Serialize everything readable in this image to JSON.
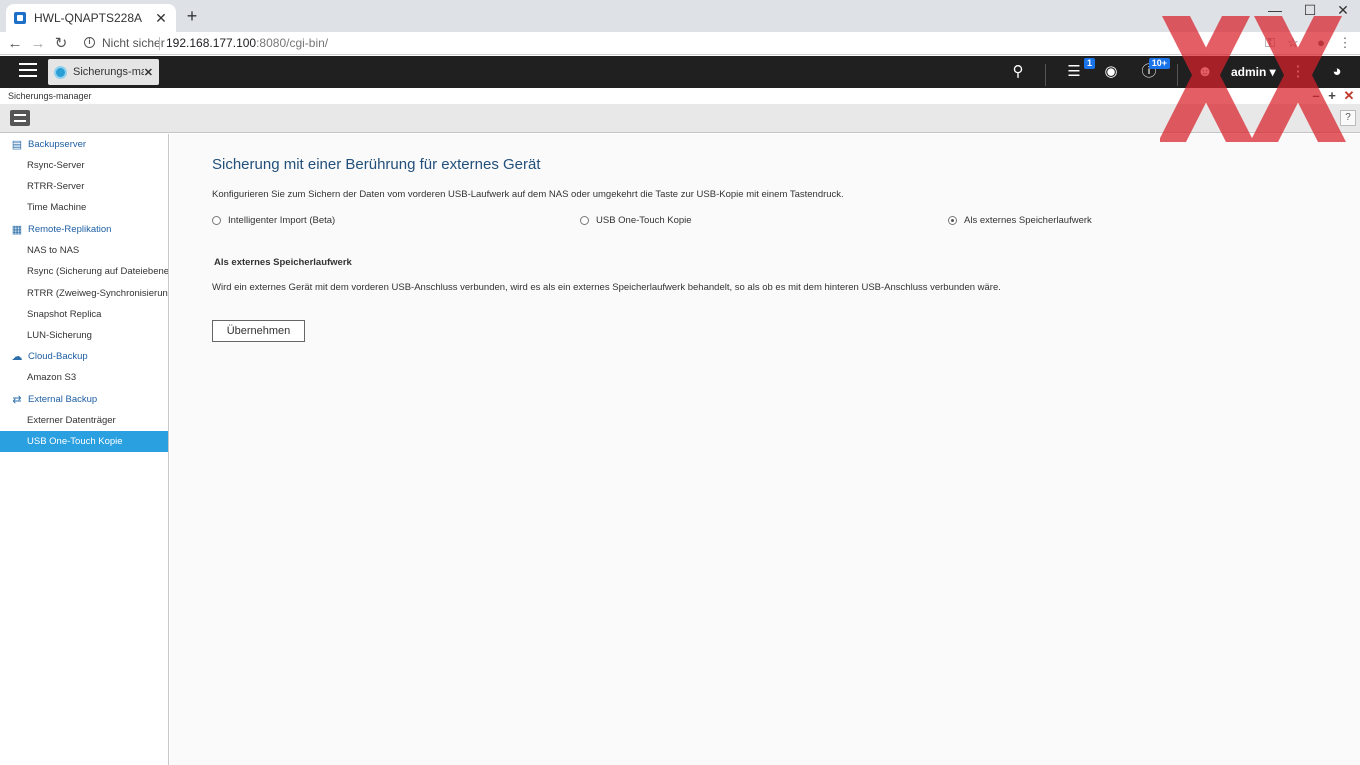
{
  "browser": {
    "tab_title": "HWL-QNAPTS228A",
    "tab_close": "✕",
    "new_tab": "+",
    "window_controls": {
      "minimize": "—",
      "maximize": "☐",
      "close": "✕"
    },
    "not_secure": "Nicht sicher",
    "url_host": "192.168.177.100",
    "url_rest": ":8080/cgi-bin/",
    "icons": [
      "back-icon",
      "forward-icon",
      "reload-icon",
      "info-icon",
      "key-icon",
      "star-icon",
      "profile-icon",
      "menu-icon"
    ]
  },
  "qts": {
    "app_tab_label": "Sicherungs-ma...",
    "app_tab_close": "✕",
    "badges": {
      "tasks": "1",
      "notifications": "10+"
    },
    "user": "admin ▾"
  },
  "window": {
    "title": "Sicherungs-manager",
    "controls": {
      "minimize": "–",
      "maximize": "+",
      "close": "✕"
    },
    "help": "?"
  },
  "sidebar": {
    "groups": [
      {
        "label": "Backupserver",
        "icon": "server-icon",
        "items": [
          "Rsync-Server",
          "RTRR-Server",
          "Time Machine"
        ]
      },
      {
        "label": "Remote-Replikation",
        "icon": "replication-icon",
        "items": [
          "NAS to NAS",
          "Rsync (Sicherung auf Dateiebene...",
          "RTRR (Zweiweg-Synchronisierun...",
          "Snapshot Replica",
          "LUN-Sicherung"
        ]
      },
      {
        "label": "Cloud-Backup",
        "icon": "cloud-icon",
        "items": [
          "Amazon S3"
        ]
      },
      {
        "label": "External Backup",
        "icon": "sync-icon",
        "items": [
          "Externer Datenträger",
          "USB One-Touch Kopie"
        ]
      }
    ],
    "active_item": "USB One-Touch Kopie"
  },
  "main": {
    "title": "Sicherung mit einer Berührung für externes Gerät",
    "description": "Konfigurieren Sie zum Sichern der Daten vom vorderen USB-Laufwerk auf dem NAS oder umgekehrt die Taste zur USB-Kopie mit einem Tastendruck.",
    "options": [
      {
        "label": "Intelligenter Import (Beta)",
        "checked": false
      },
      {
        "label": "USB One-Touch Kopie",
        "checked": false
      },
      {
        "label": "Als externes Speicherlaufwerk",
        "checked": true
      }
    ],
    "section_title": "Als externes Speicherlaufwerk",
    "section_description": "Wird ein externes Gerät mit dem vorderen USB-Anschluss verbunden, wird es als ein externes Speicherlaufwerk behandelt, so als ob es mit dem hinteren USB-Anschluss verbunden wäre.",
    "apply_button": "Übernehmen"
  },
  "colors": {
    "accent": "#2aa0e0",
    "title": "#23507b",
    "watermark": "#d9222a"
  }
}
